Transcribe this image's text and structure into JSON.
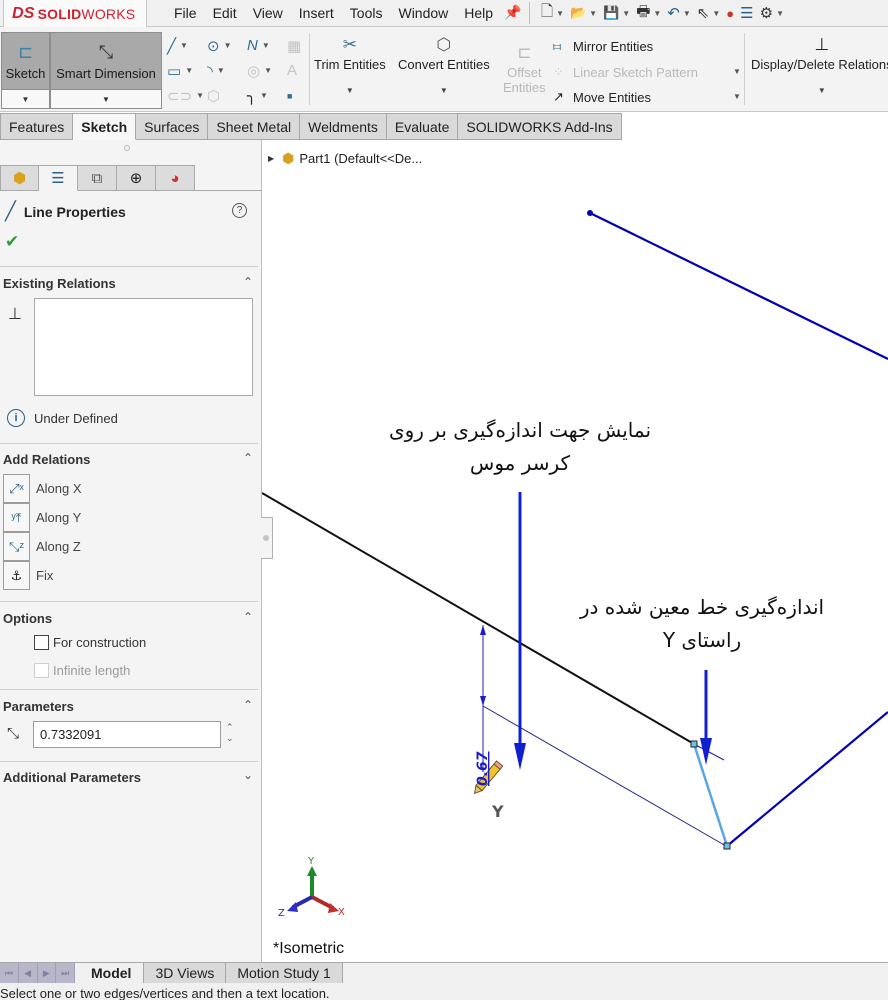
{
  "app": {
    "brand": {
      "ds": "DS",
      "solid": "SOLID",
      "works": "WORKS"
    },
    "menu": [
      "File",
      "Edit",
      "View",
      "Insert",
      "Tools",
      "Window",
      "Help"
    ],
    "quick_access": [
      {
        "name": "new-document",
        "glyph": "🗋"
      },
      {
        "name": "open-document",
        "glyph": "📂"
      },
      {
        "name": "save",
        "glyph": "💾"
      },
      {
        "name": "print",
        "glyph": "🖶"
      },
      {
        "name": "undo",
        "glyph": "↶"
      },
      {
        "name": "select",
        "glyph": "⇖"
      },
      {
        "name": "rebuild",
        "glyph": "●"
      },
      {
        "name": "file-properties",
        "glyph": "☰"
      },
      {
        "name": "options",
        "glyph": "⚙"
      }
    ]
  },
  "ribbon": {
    "sketch": "Sketch",
    "smart_dimension": "Smart Dimension",
    "trim_entities": "Trim Entities",
    "convert_entities": "Convert Entities",
    "offset_entities_1": "Offset",
    "offset_entities_2": "Entities",
    "mirror_entities": "Mirror Entities",
    "linear_sketch_pattern": "Linear Sketch Pattern",
    "move_entities": "Move Entities",
    "display_delete_relations": "Display/Delete Relations"
  },
  "command_tabs": [
    "Features",
    "Sketch",
    "Surfaces",
    "Sheet Metal",
    "Weldments",
    "Evaluate",
    "SOLIDWORKS Add-Ins"
  ],
  "active_command_tab": "Sketch",
  "property_manager": {
    "title": "Line Properties",
    "sections": {
      "existing_relations": "Existing Relations",
      "add_relations": "Add Relations",
      "options": "Options",
      "parameters": "Parameters",
      "additional_parameters": "Additional Parameters"
    },
    "status": "Under Defined",
    "relations": [
      "Along X",
      "Along Y",
      "Along Z",
      "Fix"
    ],
    "options": [
      {
        "label": "For construction",
        "checked": false,
        "enabled": true
      },
      {
        "label": "Infinite length",
        "checked": false,
        "enabled": false
      }
    ],
    "length_value": "0.7332091"
  },
  "graphics": {
    "tree_root": "Part1  (Default<<De...",
    "view_name": "*Isometric",
    "dimension_value": "0.67",
    "cursor_axis": "Y",
    "triad": {
      "x": "X",
      "y": "Y",
      "z": "Z"
    },
    "annotation_1_line1": "نمایش جهت اندازه‌گیری بر روی",
    "annotation_1_line2": "کرسر موس",
    "annotation_2_line1": "اندازه‌گیری خط معین شده در",
    "annotation_2_line2": "راستای Y",
    "colors": {
      "sketch_blue": "#0000b4",
      "selected_line": "#5aa6e0",
      "underdefined_black": "#111111",
      "arrow_blue": "#1020d0"
    }
  },
  "bottom_tabs": [
    "Model",
    "3D Views",
    "Motion Study 1"
  ],
  "active_bottom_tab": "Model",
  "status_bar": "Select one or two edges/vertices and then a text location."
}
